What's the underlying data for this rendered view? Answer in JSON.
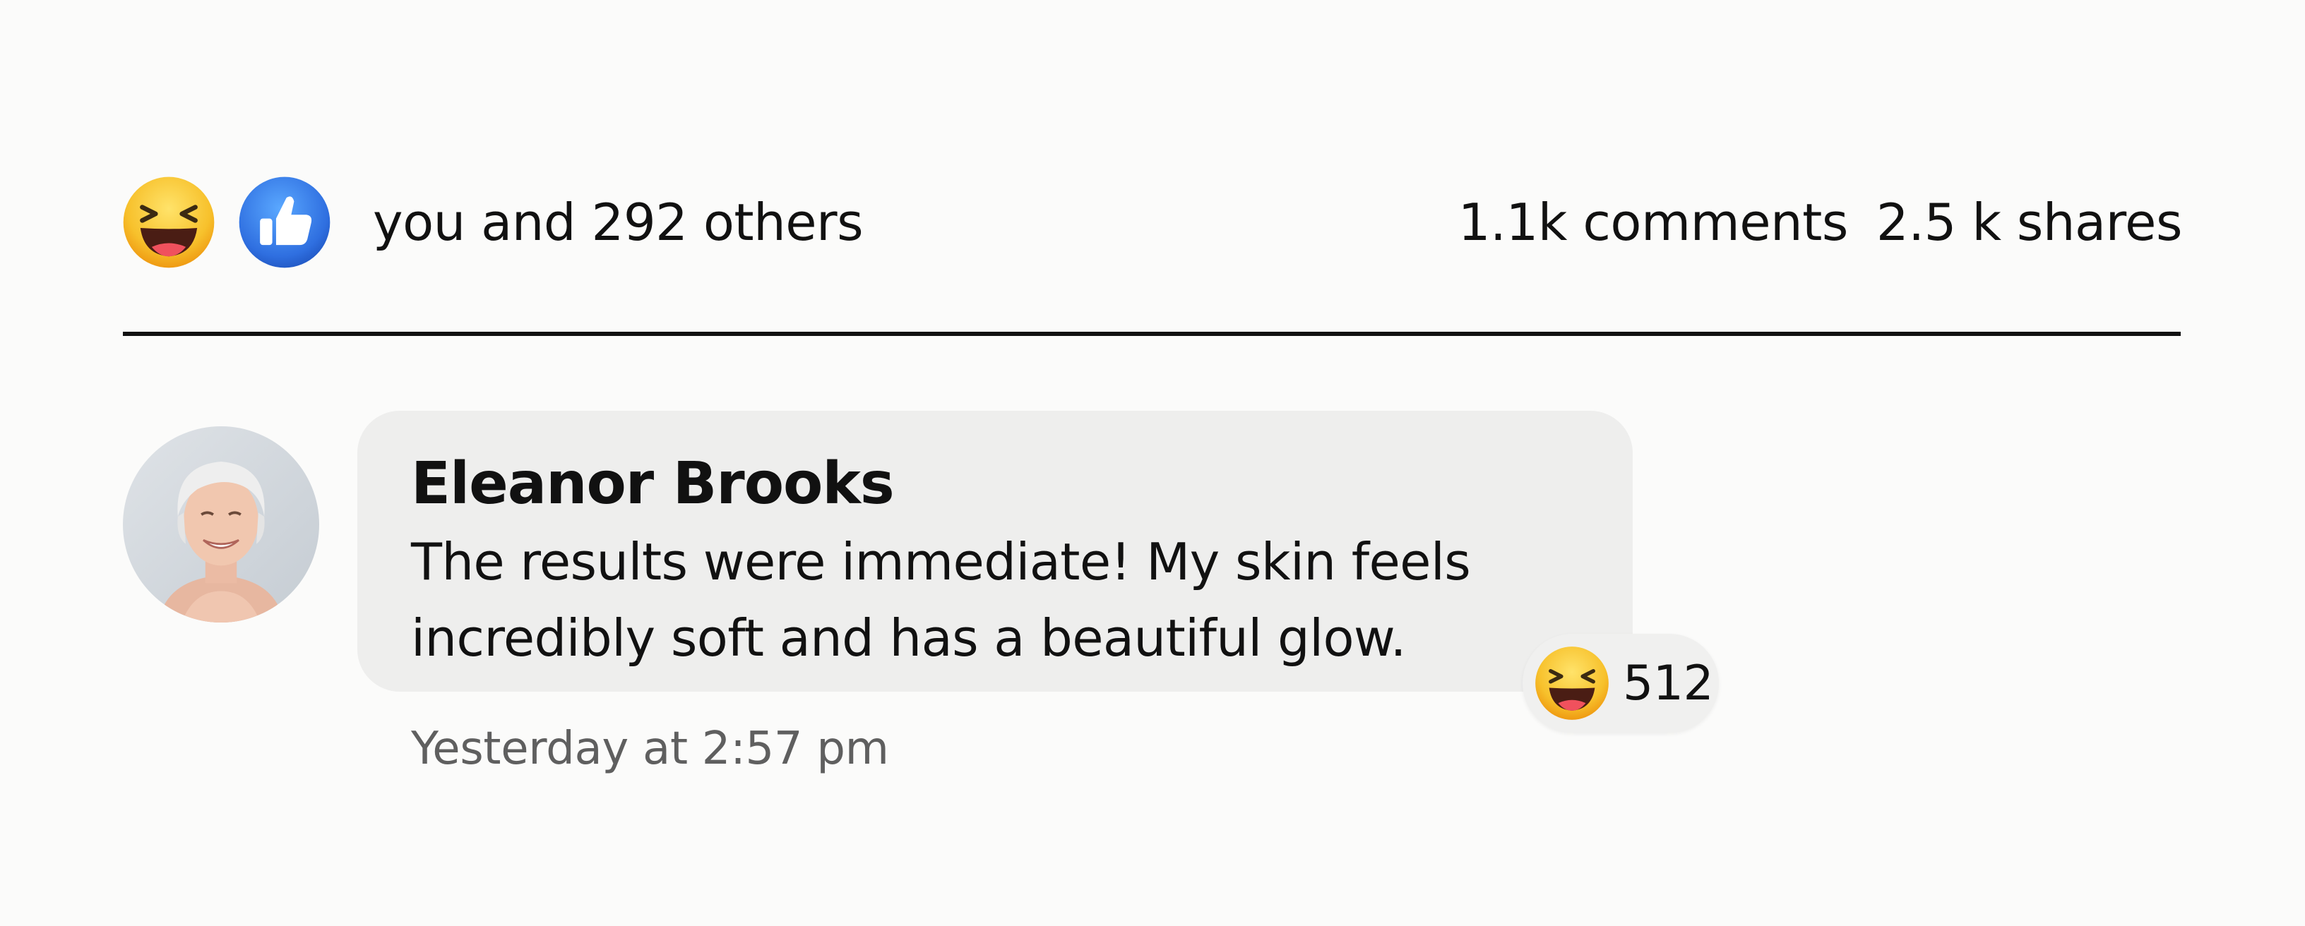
{
  "reactions": {
    "icons": [
      "haha-emoji-icon",
      "like-thumb-icon"
    ],
    "summary": "you and 292 others"
  },
  "stats": {
    "comments": "1.1k comments",
    "shares": "2.5 k shares"
  },
  "comment": {
    "author": "Eleanor Brooks",
    "text_line1": "The results were immediate! My skin feels",
    "text_line2": "incredibly soft and has a beautiful glow.",
    "reaction_icon": "haha-emoji-icon",
    "reaction_count": "512",
    "timestamp": "Yesterday at 2:57 pm"
  },
  "colors": {
    "background": "#fbfbfa",
    "bubble": "#eeeeed",
    "like_blue": "#2f6fe0",
    "haha_yellow": "#f6b21e",
    "timestamp_gray": "#5f5f5f"
  }
}
